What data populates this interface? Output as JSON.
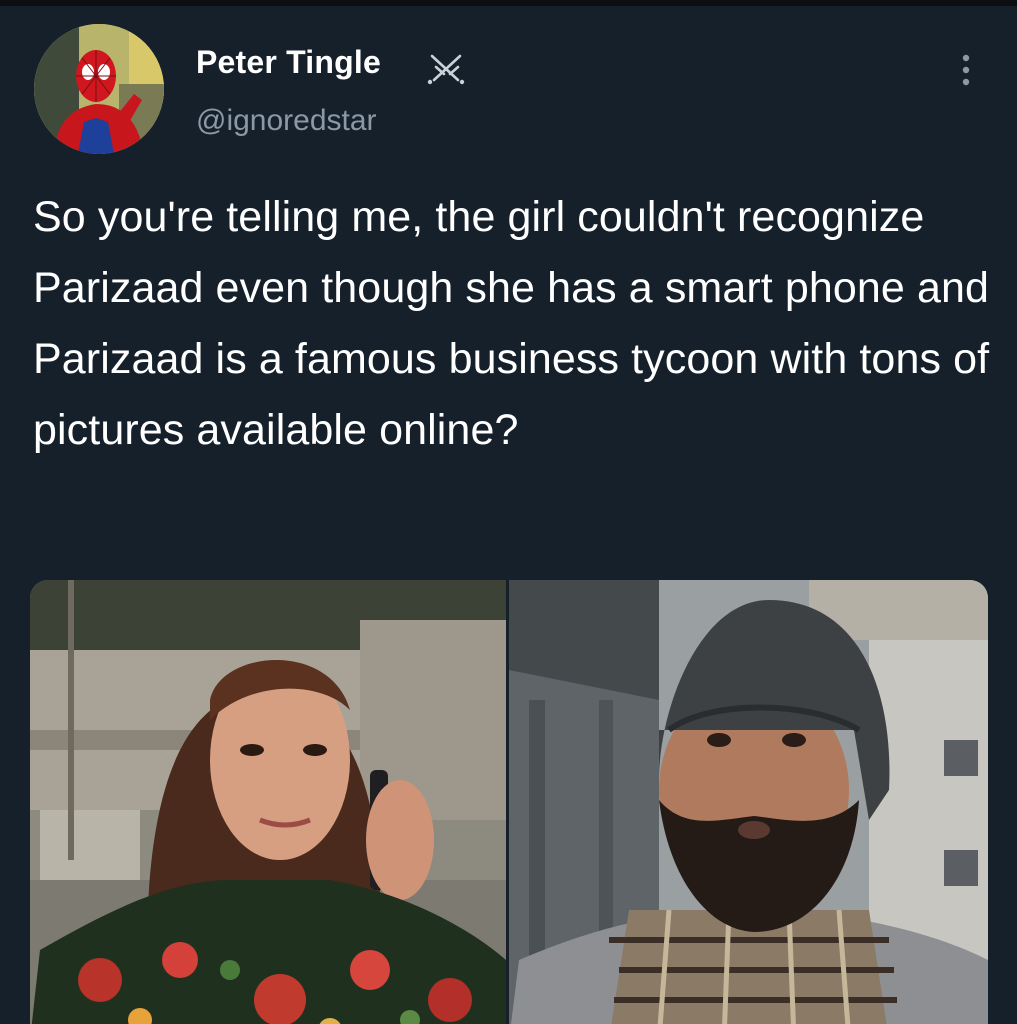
{
  "tweet": {
    "author": {
      "display_name": "Peter Tingle",
      "handle": "@ignoredstar",
      "badge_icon": "crossed-swords-icon",
      "avatar": "spiderman-avatar"
    },
    "menu_icon": "more-vertical-icon",
    "text": "So you're telling me, the girl couldn't recognize Parizaad even though she has a smart phone and Parizaad is a famous business tycoon with tons of pictures available online?",
    "media": [
      {
        "name": "woman-on-phone-photo"
      },
      {
        "name": "bearded-man-in-beanie-photo"
      }
    ]
  },
  "colors": {
    "background": "#15202b",
    "text_primary": "#ffffff",
    "text_secondary": "#8b98a5"
  }
}
